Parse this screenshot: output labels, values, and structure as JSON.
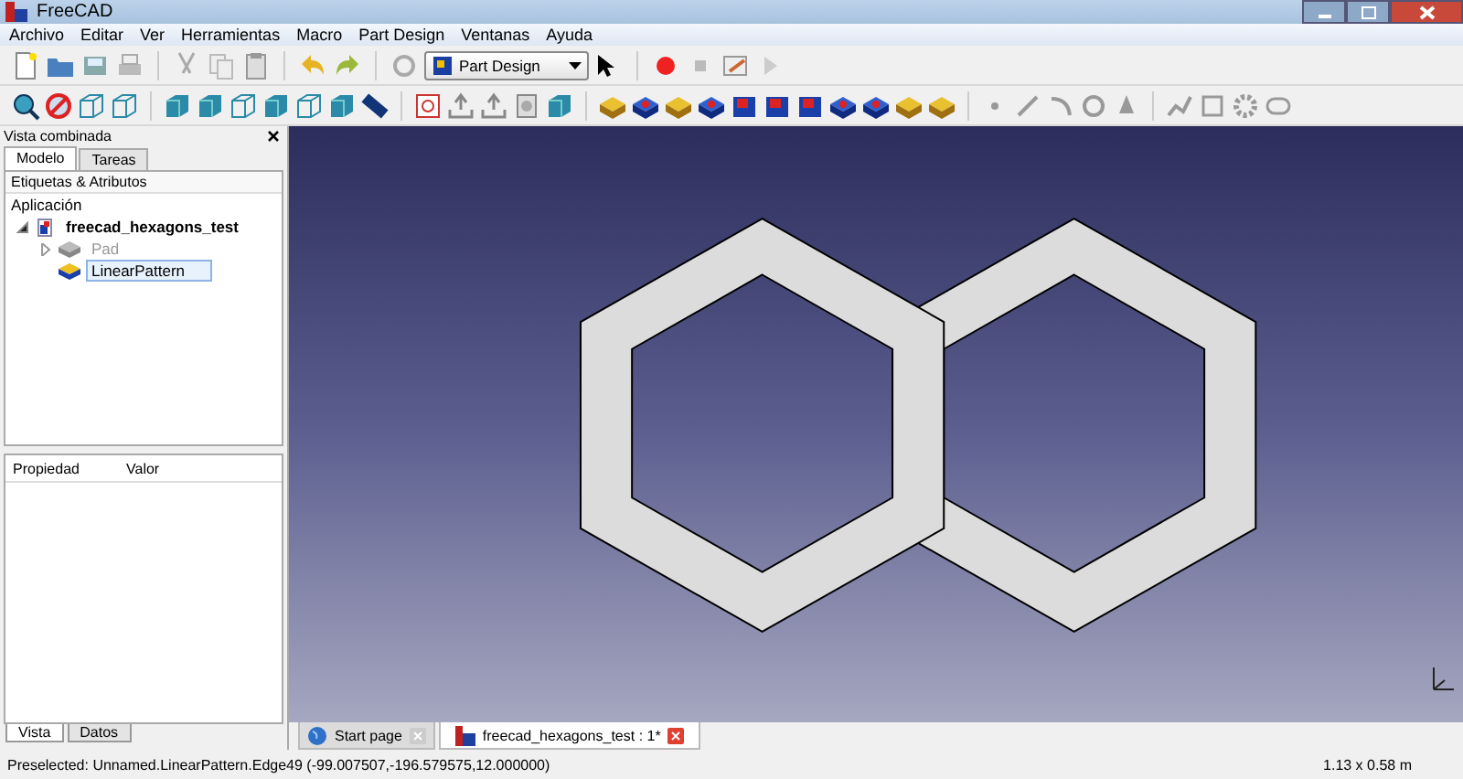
{
  "window": {
    "title": "FreeCAD"
  },
  "menu": [
    "Archivo",
    "Editar",
    "Ver",
    "Herramientas",
    "Macro",
    "Part Design",
    "Ventanas",
    "Ayuda"
  ],
  "workbench": {
    "value": "Part Design"
  },
  "combo_view": {
    "title": "Vista combinada",
    "tabs": [
      {
        "label": "Modelo",
        "selected": true
      },
      {
        "label": "Tareas",
        "selected": false
      }
    ],
    "tree_header": "Etiquetas & Atributos",
    "tree": [
      {
        "label": "Aplicación",
        "children": [
          {
            "label": "freecad_hexagons_test",
            "expanded": true,
            "selected": false,
            "hidden": false,
            "children": [
              {
                "label": "Pad",
                "expanded": false,
                "selected": false,
                "hidden": true
              },
              {
                "label": "LinearPattern",
                "selected": true,
                "hidden": false
              }
            ]
          }
        ]
      }
    ],
    "property_columns": [
      "Propiedad",
      "Valor"
    ],
    "bottom_tabs": [
      {
        "label": "Vista",
        "selected": true
      },
      {
        "label": "Datos",
        "selected": false
      }
    ]
  },
  "doc_tabs": [
    {
      "label": "Start page",
      "selected": false
    },
    {
      "label": "freecad_hexagons_test : 1*",
      "selected": true
    }
  ],
  "status_bar": {
    "message": "Preselected: Unnamed.LinearPattern.Edge49 (-99.007507,-196.579575,12.000000)",
    "dimensions": "1.13 x 0.58 m"
  }
}
